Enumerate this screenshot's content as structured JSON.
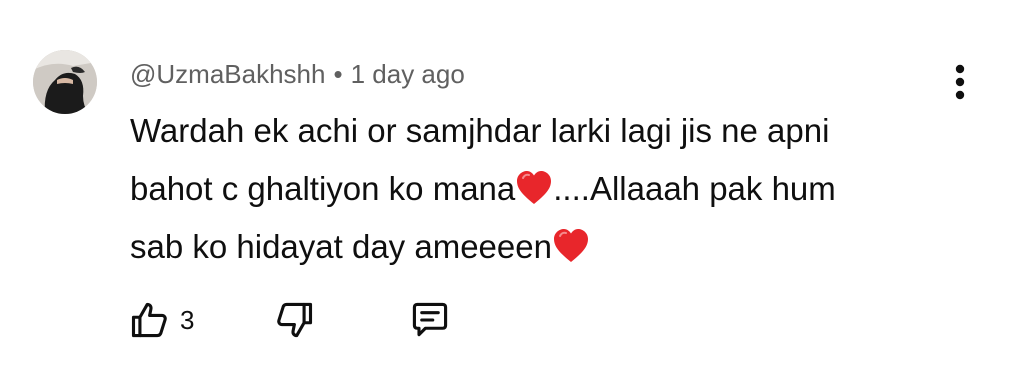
{
  "comment": {
    "author": "@UzmaBakhshh",
    "separator": "•",
    "time": "1 day ago",
    "body": {
      "line1": "Wardah ek achi or samjhdar larki lagi jis ne apni",
      "line2_before": "bahot c ghaltiyon ko mana",
      "line2_after": "....Allaaah pak hum",
      "line3": "sab ko hidayat day ameeeen"
    },
    "like_count": "3"
  },
  "icons": {
    "menu": "more-vertical-icon",
    "like": "thumbs-up-icon",
    "dislike": "thumbs-down-icon",
    "reply": "comment-icon",
    "emoji": "red-heart"
  },
  "colors": {
    "text": "#0f0f0f",
    "meta": "#606060",
    "heart": "#e8262b"
  }
}
